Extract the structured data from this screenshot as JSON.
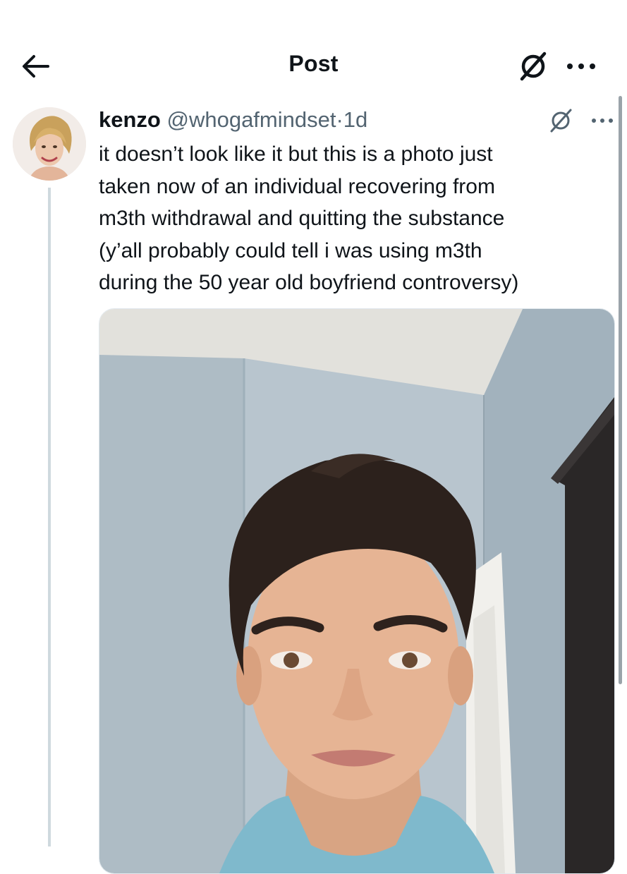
{
  "header": {
    "title": "Post",
    "back_icon": "arrow-left-icon",
    "grok_icon": "grok-icon",
    "more_icon": "more-horizontal-icon"
  },
  "post": {
    "display_name": "kenzo",
    "handle": "@whogafmindset",
    "separator": "·",
    "time": "1d",
    "text_lines": [
      "it doesn’t look like it but this is a photo just",
      "taken now of an individual recovering from",
      "m3th withdrawal and quitting the substance",
      "(y’all probably could tell i was using m3th",
      "during the 50 year old boyfriend controversy)"
    ]
  },
  "colors": {
    "text": "#0f1419",
    "secondary": "#536471",
    "thread_line": "#cfd9de"
  }
}
